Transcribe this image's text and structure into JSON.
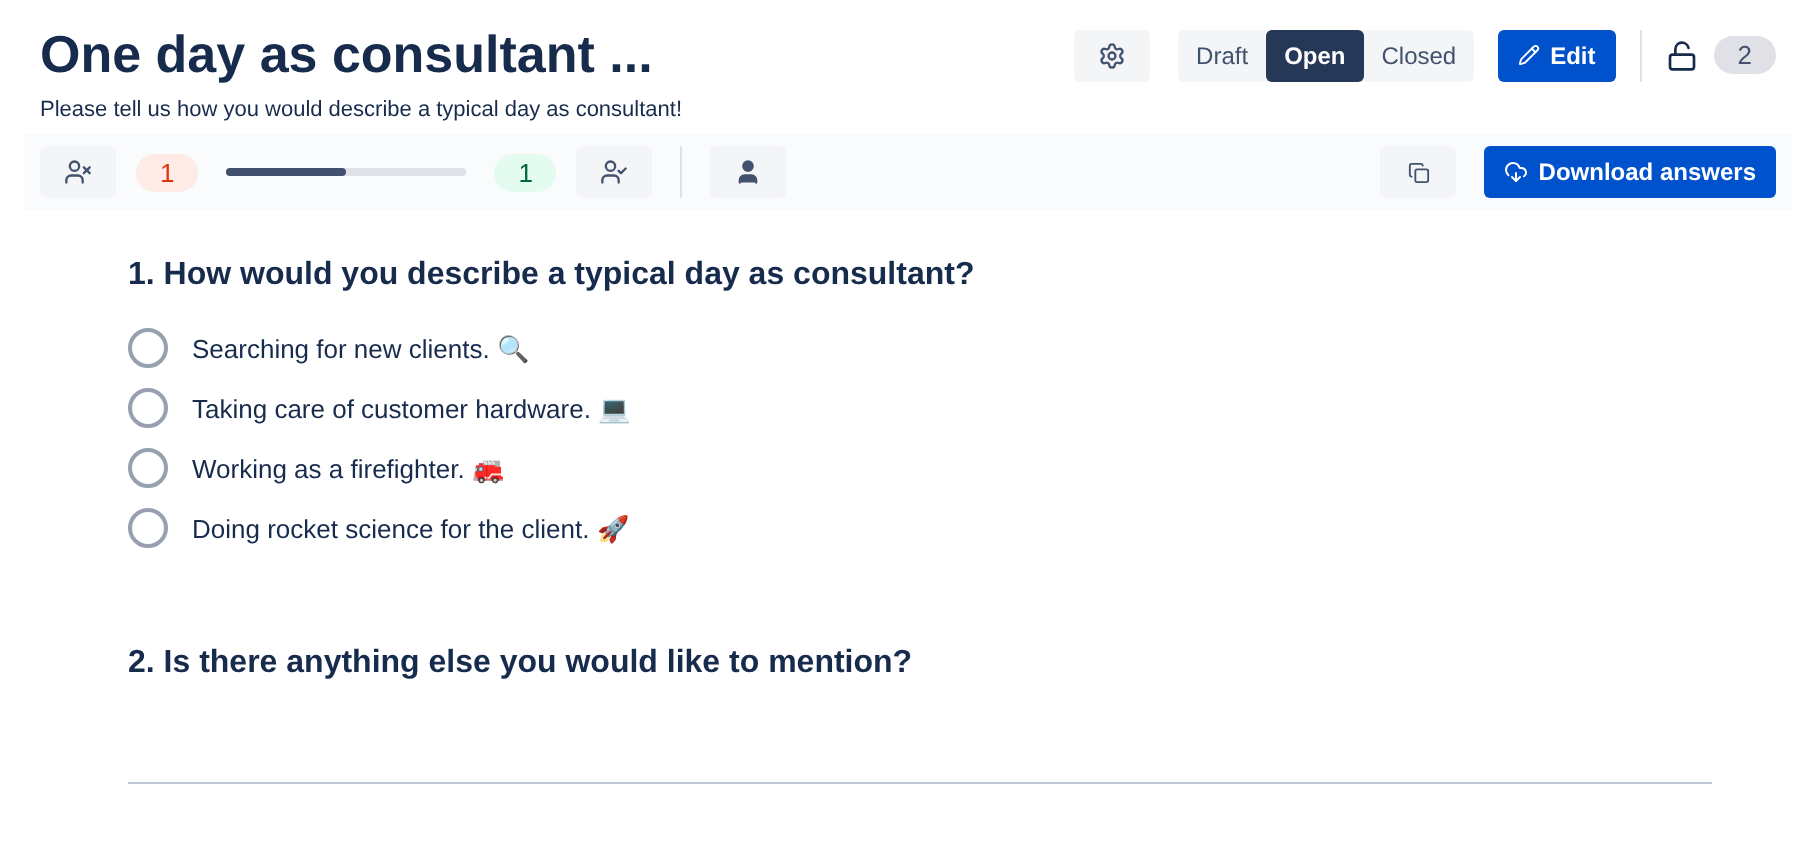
{
  "title": "One day as consultant ...",
  "description": "Please tell us how you would describe a typical day as consultant!",
  "status_tabs": [
    {
      "label": "Draft",
      "selected": false
    },
    {
      "label": "Open",
      "selected": true
    },
    {
      "label": "Closed",
      "selected": false
    }
  ],
  "edit_button": "Edit",
  "lock_count": "2",
  "stats": {
    "declined": "1",
    "progress": {
      "level": 0.5
    },
    "accepted": "1"
  },
  "download_button": "Download answers",
  "questions": [
    {
      "kind": "choice",
      "title": "1. How would you describe a typical day as consultant?",
      "options": [
        {
          "label": "Searching for new clients. 🔍",
          "selected": false
        },
        {
          "label": "Taking care of customer hardware. 💻",
          "selected": false
        },
        {
          "label": "Working as a firefighter. 🚒",
          "selected": false
        },
        {
          "label": "Doing rocket science for the client. 🚀",
          "selected": false
        }
      ]
    },
    {
      "kind": "text",
      "title": "2. Is there anything else you would like to mention?"
    }
  ]
}
